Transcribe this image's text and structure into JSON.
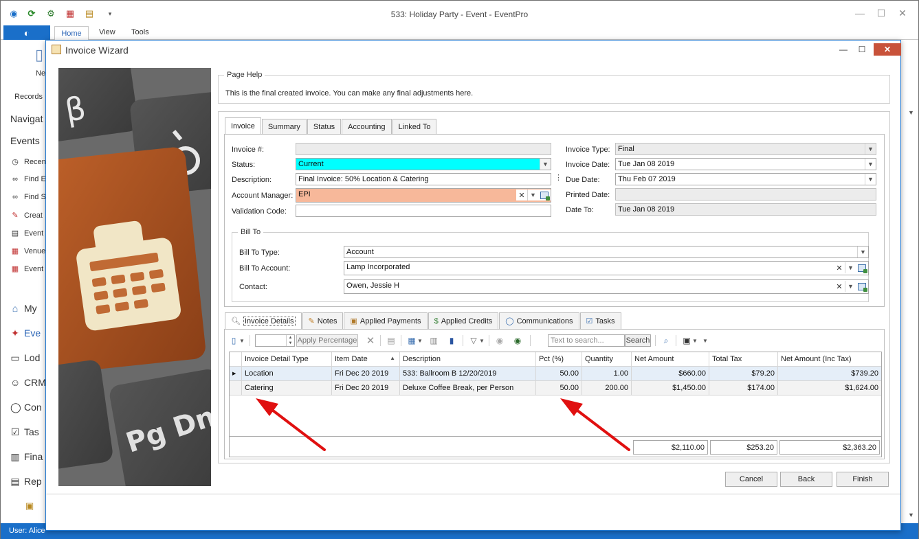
{
  "app": {
    "title": "533: Holiday Party - Event - EventPro",
    "ribbon_tabs": [
      "Home",
      "View",
      "Tools"
    ],
    "ribbon_fragments": {
      "new": "Ne",
      "records": "Records"
    },
    "nav_title": "Navigat",
    "nav_section": "Events",
    "nav_items": [
      "Recen",
      "Find E",
      "Find S",
      "Creat",
      "Event",
      "Venue",
      "Event"
    ],
    "modules": [
      "My",
      "Eve",
      "Lod",
      "CRM",
      "Con",
      "Tas",
      "Fina",
      "Rep"
    ],
    "status_user": "User: Alice"
  },
  "dialog": {
    "title": "Invoice Wizard",
    "page_help": {
      "legend": "Page Help",
      "text": "This is the final created invoice.  You can make any final adjustments here."
    },
    "top_tabs": [
      "Invoice",
      "Summary",
      "Status",
      "Accounting",
      "Linked To"
    ],
    "invoice": {
      "invoice_no_label": "Invoice #:",
      "invoice_no": "",
      "status_label": "Status:",
      "status": "Current",
      "description_label": "Description:",
      "description": "Final Invoice: 50% Location & Catering",
      "account_manager_label": "Account Manager:",
      "account_manager": "EPI",
      "validation_code_label": "Validation Code:",
      "validation_code": "",
      "invoice_type_label": "Invoice Type:",
      "invoice_type": "Final",
      "invoice_date_label": "Invoice Date:",
      "invoice_date": "Tue Jan 08 2019",
      "due_date_label": "Due Date:",
      "due_date": "Thu Feb 07 2019",
      "printed_date_label": "Printed Date:",
      "printed_date": "",
      "date_to_label": "Date To:",
      "date_to": "Tue Jan 08 2019"
    },
    "bill_to": {
      "legend": "Bill To",
      "type_label": "Bill To Type:",
      "type": "Account",
      "account_label": "Bill To Account:",
      "account": "Lamp Incorporated",
      "contact_label": "Contact:",
      "contact": "Owen, Jessie H"
    },
    "detail_tabs": [
      "Invoice Details",
      "Notes",
      "Applied Payments",
      "Applied Credits",
      "Communications",
      "Tasks"
    ],
    "toolbar": {
      "apply_percentage": "Apply Percentage",
      "search_placeholder": "Text to search...",
      "search_button": "Search"
    },
    "grid": {
      "columns": [
        "Invoice Detail Type",
        "Item Date",
        "Description",
        "Pct (%)",
        "Quantity",
        "Net Amount",
        "Total Tax",
        "Net Amount (Inc Tax)"
      ],
      "rows": [
        [
          "Location",
          "Fri Dec 20 2019",
          "533: Ballroom B 12/20/2019",
          "50.00",
          "1.00",
          "$660.00",
          "$79.20",
          "$739.20"
        ],
        [
          "Catering",
          "Fri Dec 20 2019",
          "Deluxe Coffee Break, per Person",
          "50.00",
          "200.00",
          "$1,450.00",
          "$174.00",
          "$1,624.00"
        ]
      ],
      "totals": {
        "net_amount": "$2,110.00",
        "total_tax": "$253.20",
        "net_inc_tax": "$2,363.20"
      }
    },
    "buttons": {
      "cancel": "Cancel",
      "back": "Back",
      "finish": "Finish"
    }
  },
  "colors": {
    "status_current": "#00ffff",
    "account_manager": "#f7b89a",
    "accent": "#1a6fc9",
    "annotation_arrow": "#e01010"
  }
}
